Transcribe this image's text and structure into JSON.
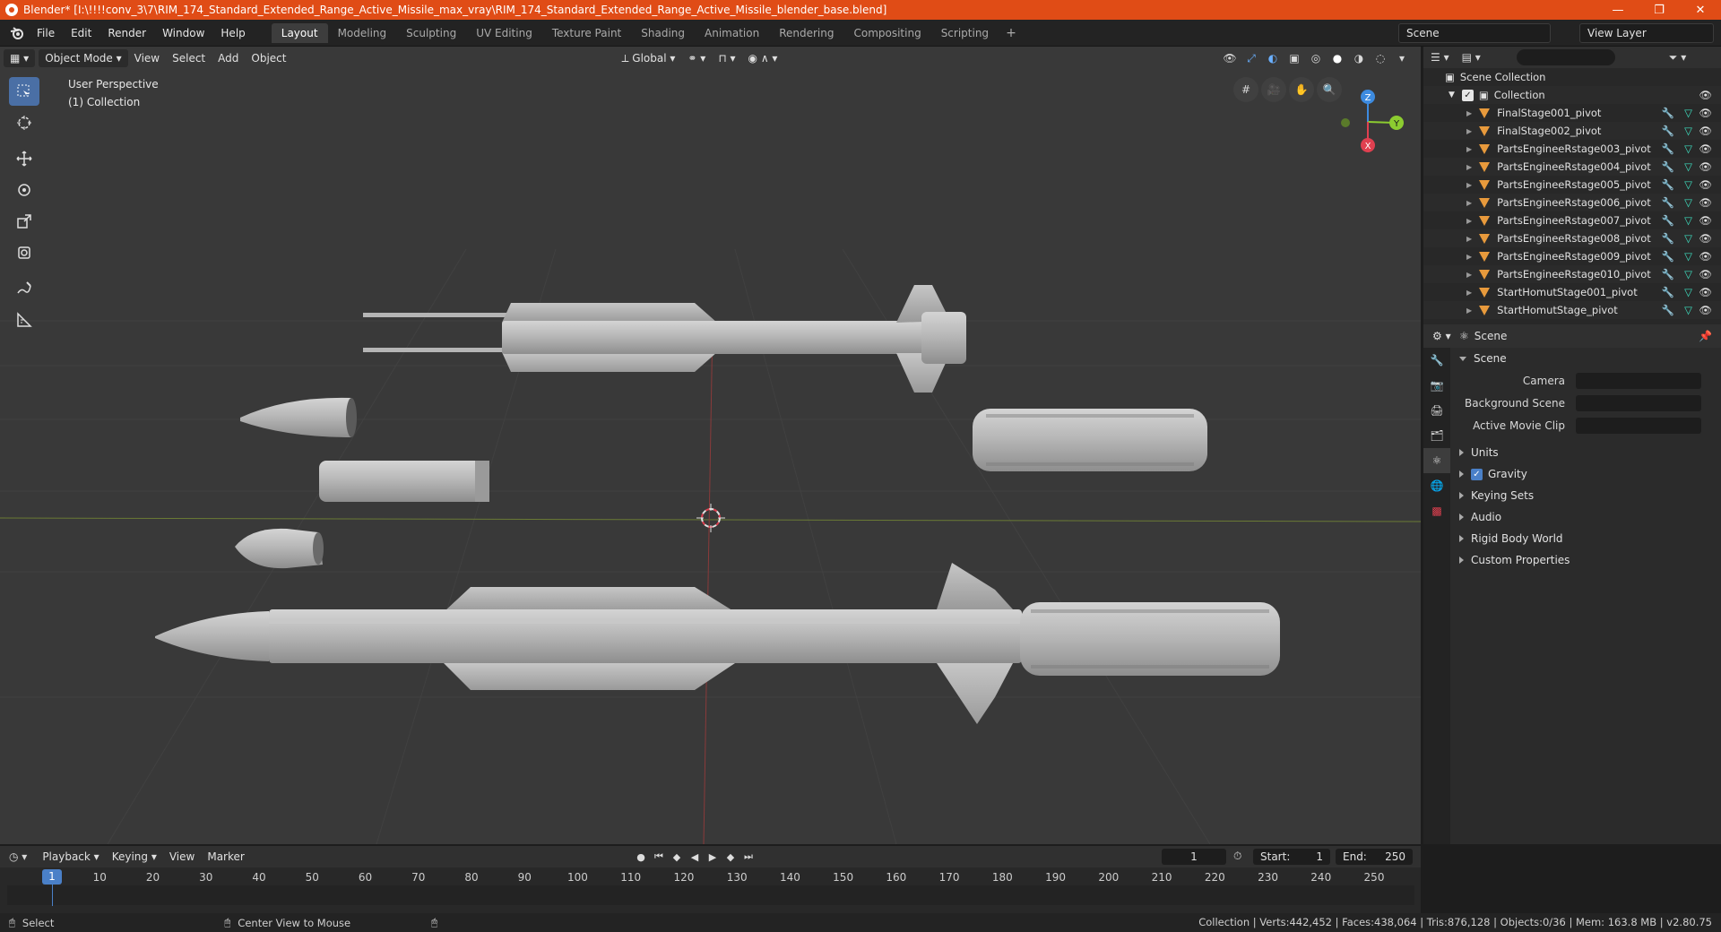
{
  "window": {
    "title": "Blender* [I:\\!!!!conv_3\\7\\RIM_174_Standard_Extended_Range_Active_Missile_max_vray\\RIM_174_Standard_Extended_Range_Active_Missile_blender_base.blend]",
    "minimize": "—",
    "maximize": "❐",
    "close": "✕"
  },
  "menu": [
    "File",
    "Edit",
    "Render",
    "Window",
    "Help"
  ],
  "workspaces": [
    "Layout",
    "Modeling",
    "Sculpting",
    "UV Editing",
    "Texture Paint",
    "Shading",
    "Animation",
    "Rendering",
    "Compositing",
    "Scripting"
  ],
  "workspace_add": "+",
  "scene_selector": "Scene",
  "view_layer_selector": "View Layer",
  "viewport": {
    "mode": "Object Mode",
    "menus": [
      "View",
      "Select",
      "Add",
      "Object"
    ],
    "transform_orientation": "Global",
    "info_line1": "User Perspective",
    "info_line2": "(1) Collection",
    "gizmo": {
      "z": "Z",
      "y": "Y",
      "x": "X"
    }
  },
  "outliner": {
    "root": "Scene Collection",
    "collection": "Collection",
    "items": [
      "FinalStage001_pivot",
      "FinalStage002_pivot",
      "PartsEngineeRstage003_pivot",
      "PartsEngineeRstage004_pivot",
      "PartsEngineeRstage005_pivot",
      "PartsEngineeRstage006_pivot",
      "PartsEngineeRstage007_pivot",
      "PartsEngineeRstage008_pivot",
      "PartsEngineeRstage009_pivot",
      "PartsEngineeRstage010_pivot",
      "StartHomutStage001_pivot",
      "StartHomutStage_pivot"
    ]
  },
  "properties": {
    "header": "Scene",
    "panel": "Scene",
    "fields": [
      {
        "label": "Camera"
      },
      {
        "label": "Background Scene"
      },
      {
        "label": "Active Movie Clip"
      }
    ],
    "sections": [
      "Units",
      "Gravity",
      "Keying Sets",
      "Audio",
      "Rigid Body World",
      "Custom Properties"
    ],
    "gravity_checked": "✓"
  },
  "timeline": {
    "menus": [
      "Playback",
      "Keying",
      "View",
      "Marker"
    ],
    "current_frame": "1",
    "start_label": "Start:",
    "start": "1",
    "end_label": "End:",
    "end": "250",
    "ticks": [
      "1",
      "10",
      "20",
      "30",
      "40",
      "50",
      "60",
      "70",
      "80",
      "90",
      "100",
      "110",
      "120",
      "130",
      "140",
      "150",
      "160",
      "170",
      "180",
      "190",
      "200",
      "210",
      "220",
      "230",
      "240",
      "250"
    ]
  },
  "statusbar": {
    "left_action": "Select",
    "mid_action": "Center View to Mouse",
    "stats": "Collection | Verts:442,452 | Faces:438,064 | Tris:876,128 | Objects:0/36 | Mem: 163.8 MB | v2.80.75"
  },
  "colors": {
    "titlebar": "#e04c16",
    "viewport_bg": "#393939",
    "accent": "#4a80c8",
    "object_icon": "#e89a3c",
    "axis_x": "#e04050",
    "axis_y": "#8ccc30",
    "axis_z": "#3d8be0"
  }
}
